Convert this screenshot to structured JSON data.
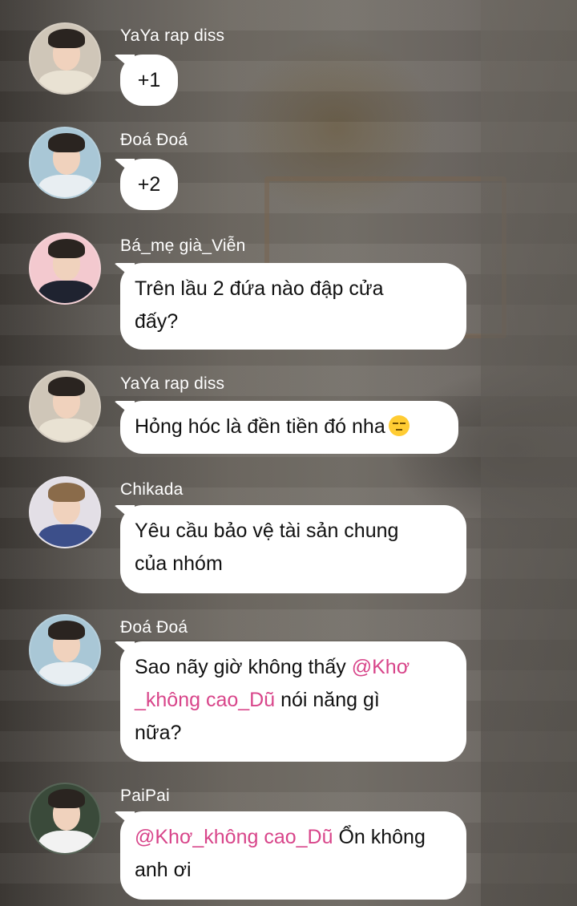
{
  "messages": [
    {
      "sender": "YaYa rap diss",
      "text": "+1"
    },
    {
      "sender": "Đoá Đoá",
      "text": "+2"
    },
    {
      "sender": "Bá_mẹ già_Viễn",
      "text_line1": "Trên lầu 2 đứa nào đập cửa",
      "text_line2": "đấy?"
    },
    {
      "sender": "YaYa rap diss",
      "text": "Hỏng hóc là đền tiền đó nha",
      "emoji": "unamused-face-icon"
    },
    {
      "sender": "Chikada",
      "text_line1": "Yêu cầu bảo vệ tài sản chung",
      "text_line2": "của nhóm"
    },
    {
      "sender": "Đoá Đoá",
      "text_a": "Sao nãy giờ không thấy ",
      "mention_a": "@Khơ",
      "mention_b": "_không cao_Dũ",
      "text_b": " nói năng gì",
      "text_c": "nữa?"
    },
    {
      "sender": "PaiPai",
      "mention": "@Khơ_không cao_Dũ",
      "text_a": " Ổn không",
      "text_b": "anh ơi"
    }
  ],
  "colors": {
    "bubble": "#ffffff",
    "mention": "#d8458a",
    "name": "#ffffff"
  }
}
